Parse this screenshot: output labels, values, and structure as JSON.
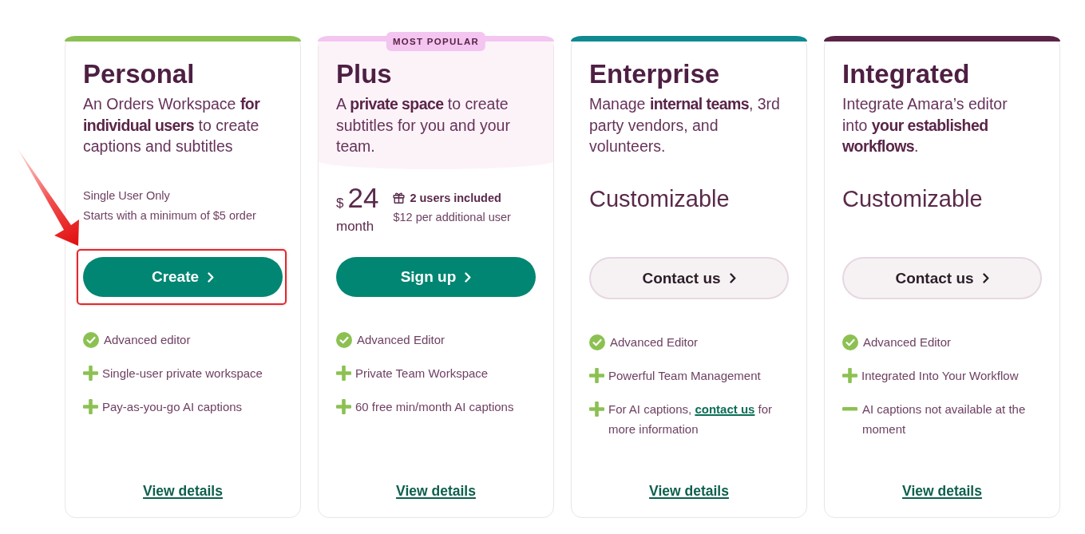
{
  "plans": [
    {
      "name": "Personal",
      "color": "#8cc152",
      "featured": false,
      "description": "An Orders Workspace **for individual users** to create captions and subtitles",
      "pricing": {
        "kind": "notes",
        "lines": [
          "Single User Only",
          "Starts with a minimum of $5 order"
        ]
      },
      "button": {
        "label": "Create",
        "kind": "primary",
        "highlighted": true
      },
      "features": [
        {
          "kind": "check",
          "text": "Advanced editor"
        },
        {
          "kind": "plus",
          "text": "Single-user private workspace"
        },
        {
          "kind": "plus",
          "text": "Pay-as-you-go AI captions"
        }
      ],
      "details_link": "View details"
    },
    {
      "name": "Plus",
      "color": "#f3c5f0",
      "featured": true,
      "badge": "MOST POPULAR",
      "description": "A **private space** to create subtitles for you and your team.",
      "pricing": {
        "kind": "price",
        "currency": "$",
        "amount": "24",
        "period": "month",
        "included": "2 users included",
        "extra": "$12 per additional user"
      },
      "button": {
        "label": "Sign up",
        "kind": "primary",
        "highlighted": false
      },
      "features": [
        {
          "kind": "check",
          "text": "Advanced Editor"
        },
        {
          "kind": "plus",
          "text": "Private Team Workspace"
        },
        {
          "kind": "plus",
          "text": "60 free min/month AI captions"
        }
      ],
      "details_link": "View details"
    },
    {
      "name": "Enterprise",
      "color": "#0e8a90",
      "featured": false,
      "description": "Manage **internal teams**, 3rd party vendors, and volunteers.",
      "pricing": {
        "kind": "custom",
        "label": "Customizable"
      },
      "button": {
        "label": "Contact us",
        "kind": "secondary",
        "highlighted": false
      },
      "features": [
        {
          "kind": "check",
          "text": "Advanced Editor"
        },
        {
          "kind": "plus",
          "text": "Powerful Team Management"
        },
        {
          "kind": "plus",
          "text": "For AI captions, ",
          "link": "contact us",
          "text_after": " for more information"
        }
      ],
      "details_link": "View details"
    },
    {
      "name": "Integrated",
      "color": "#5a2347",
      "featured": false,
      "description": "Integrate Amara’s editor into **your established workflows**.",
      "pricing": {
        "kind": "custom",
        "label": "Customizable"
      },
      "button": {
        "label": "Contact us",
        "kind": "secondary",
        "highlighted": false
      },
      "features": [
        {
          "kind": "check",
          "text": "Advanced Editor"
        },
        {
          "kind": "plus",
          "text": "Integrated Into Your Workflow"
        },
        {
          "kind": "minus",
          "text": "AI captions not available at the moment"
        }
      ],
      "details_link": "View details"
    }
  ]
}
